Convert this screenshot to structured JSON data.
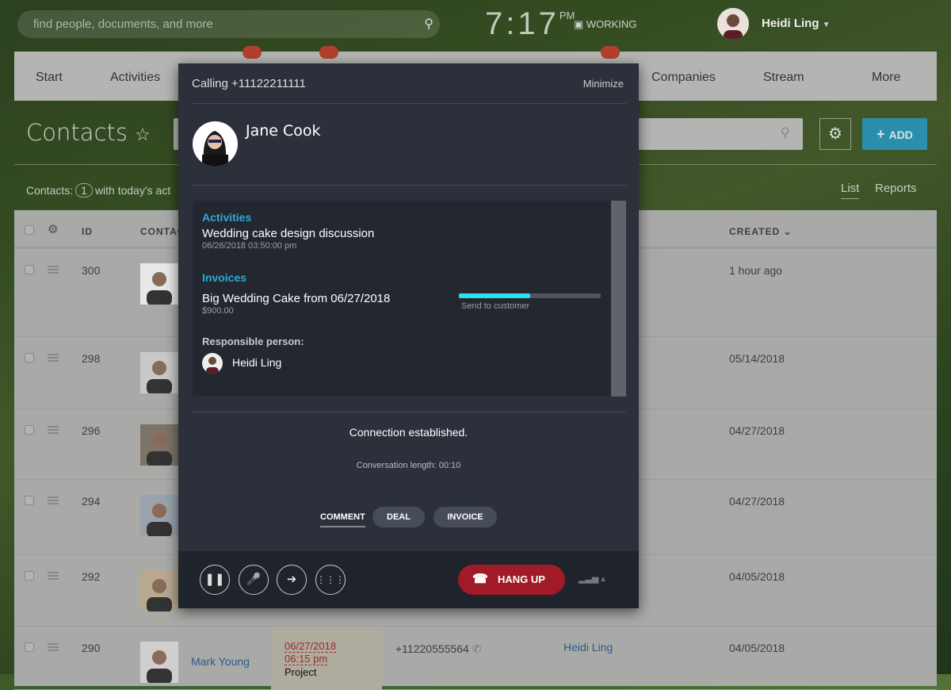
{
  "topbar": {
    "search_placeholder": "find people, documents, and more",
    "time": "7:17",
    "ampm": "PM",
    "status": "WORKING",
    "user": "Heidi Ling"
  },
  "nav": {
    "items": [
      "Start",
      "Activities",
      "Companies",
      "Stream",
      "More"
    ]
  },
  "page": {
    "title": "Contacts",
    "add_label": "ADD",
    "counter_label": "Contacts:",
    "counter_value": "1",
    "counter_suffix": "with today's act",
    "view_list": "List",
    "view_reports": "Reports"
  },
  "table": {
    "headers": {
      "id": "ID",
      "contact": "CONTAC",
      "created": "CREATED"
    },
    "rows": [
      {
        "id": "300",
        "created": "1 hour ago"
      },
      {
        "id": "298",
        "created": "05/14/2018"
      },
      {
        "id": "296",
        "created": "04/27/2018"
      },
      {
        "id": "294",
        "created": "04/27/2018"
      },
      {
        "id": "292",
        "created": "04/05/2018"
      },
      {
        "id": "290",
        "created": "04/05/2018",
        "name": "Mark Young",
        "deadline_date": "06/27/2018",
        "deadline_time": "06:15 pm",
        "deal": "Project",
        "phone": "+11220555564",
        "responsible": "Heidi Ling"
      }
    ]
  },
  "call": {
    "title": "Calling +11122211111",
    "minimize": "Minimize",
    "contact_name": "Jane Cook",
    "activities_label": "Activities",
    "activity_title": "Wedding cake design discussion",
    "activity_date": "06/26/2018 03:50:00 pm",
    "invoices_label": "Invoices",
    "invoice_title": "Big Wedding Cake from 06/27/2018",
    "invoice_amount": "$900.00",
    "invoice_stage": "Send to customer",
    "invoice_progress": 0.5,
    "responsible_label": "Responsible person:",
    "responsible_name": "Heidi Ling",
    "status": "Connection established.",
    "length": "Conversation length: 00:10",
    "tabs": [
      "COMMENT",
      "DEAL",
      "INVOICE"
    ],
    "hangup": "HANG UP"
  },
  "colors": {
    "accent": "#2eaad3",
    "hangup": "#a01a27",
    "progress": "#2de0f0"
  }
}
